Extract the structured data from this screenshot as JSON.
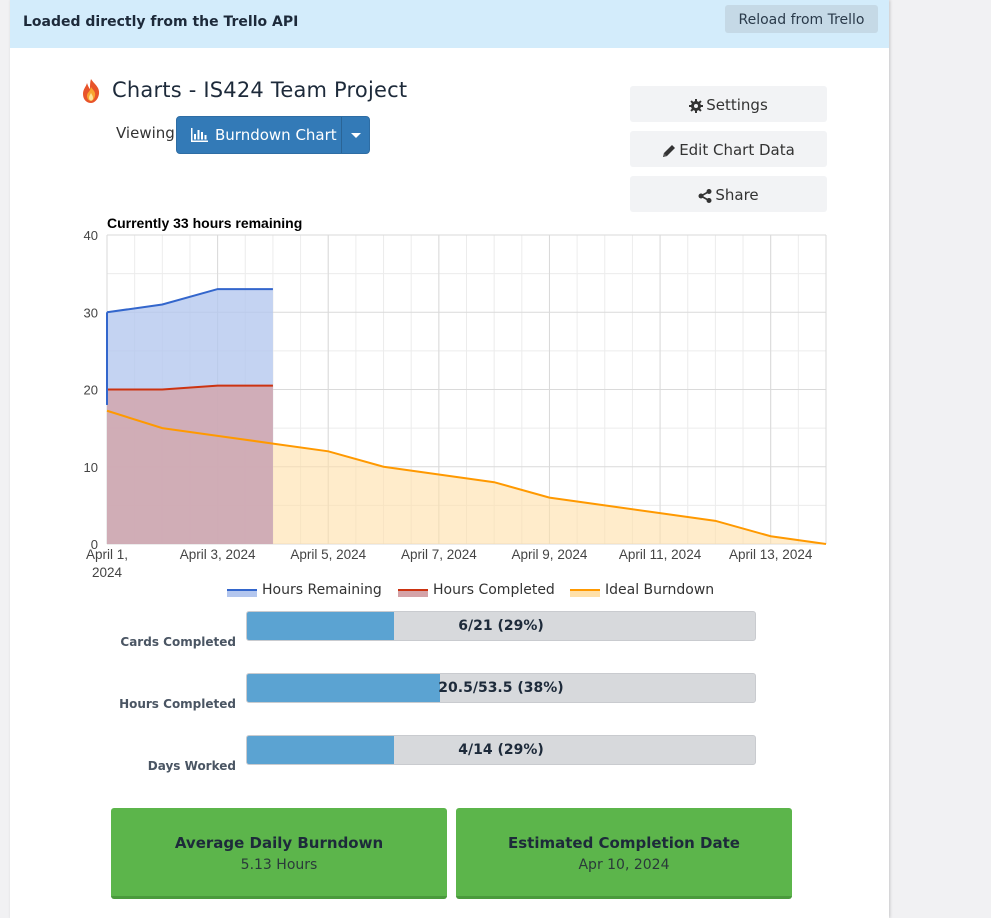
{
  "topbar": {
    "message": "Loaded directly from the Trello API",
    "reload_label": "Reload from Trello"
  },
  "header": {
    "title": "Charts - IS424 Team Project",
    "viewing_label": "Viewing",
    "view_selected": "Burndown Chart"
  },
  "actions": {
    "settings_label": "Settings",
    "edit_label": "Edit Chart Data",
    "share_label": "Share"
  },
  "chart_data": {
    "type": "area",
    "title": "Currently 33 hours remaining",
    "x": [
      "April 1, 2024",
      "April 2, 2024",
      "April 3, 2024",
      "April 4, 2024",
      "April 5, 2024",
      "April 6, 2024",
      "April 7, 2024",
      "April 8, 2024",
      "April 9, 2024",
      "April 10, 2024",
      "April 11, 2024",
      "April 12, 2024",
      "April 13, 2024",
      "April 14, 2024"
    ],
    "x_tick_labels": [
      "April 1, 2024",
      "April 3, 2024",
      "April 5, 2024",
      "April 7, 2024",
      "April 9, 2024",
      "April 11, 2024",
      "April 13, 2024"
    ],
    "ylim": [
      0,
      40
    ],
    "y_ticks": [
      0,
      10,
      20,
      30,
      40
    ],
    "grid": true,
    "legend_position": "bottom",
    "series": [
      {
        "name": "Hours Remaining",
        "color": "#3366cc",
        "fill": "#b3c6ee",
        "values": [
          30,
          31,
          33,
          33
        ]
      },
      {
        "name": "Hours Completed",
        "color": "#cc3311",
        "fill": "#d4a3a8",
        "values": [
          20,
          20,
          20.5,
          20.5
        ]
      },
      {
        "name": "Ideal Burndown",
        "color": "#ff9900",
        "fill": "#ffe0a8",
        "values": [
          17.25,
          15,
          14,
          13,
          12,
          10,
          9,
          8,
          6,
          5,
          4,
          3,
          1,
          0
        ]
      }
    ]
  },
  "stats": [
    {
      "label": "Cards Completed",
      "text": "6/21 (29%)",
      "fraction": 0.29
    },
    {
      "label": "Hours Completed",
      "text": "20.5/53.5 (38%)",
      "fraction": 0.38
    },
    {
      "label": "Days Worked",
      "text": "4/14 (29%)",
      "fraction": 0.29
    }
  ],
  "summary": {
    "avg_title": "Average Daily Burndown",
    "avg_value": "5.13 Hours",
    "est_title": "Estimated Completion Date",
    "est_value": "Apr 10, 2024"
  },
  "colors": {
    "topbar_bg": "#d3ecfb",
    "primary": "#337ab7",
    "success": "#5cb54b",
    "progress_fill": "#5ba3d2"
  }
}
